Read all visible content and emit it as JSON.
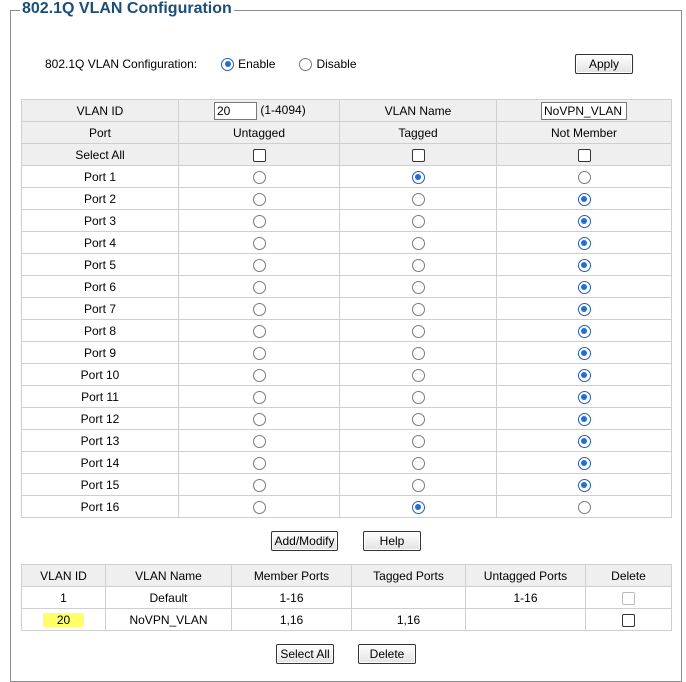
{
  "title": "802.1Q VLAN Configuration",
  "config": {
    "label": "802.1Q VLAN Configuration:",
    "enable_label": "Enable",
    "disable_label": "Disable",
    "enabled": true,
    "apply_label": "Apply"
  },
  "vlan_form": {
    "vlan_id_label": "VLAN ID",
    "vlan_id_value": "20",
    "vlan_id_range": "(1-4094)",
    "vlan_name_label": "VLAN Name",
    "vlan_name_value": "NoVPN_VLAN"
  },
  "port_table": {
    "headers": [
      "Port",
      "Untagged",
      "Tagged",
      "Not Member"
    ],
    "select_all_label": "Select All",
    "ports": [
      {
        "name": "Port 1",
        "mode": "tagged"
      },
      {
        "name": "Port 2",
        "mode": "not_member"
      },
      {
        "name": "Port 3",
        "mode": "not_member"
      },
      {
        "name": "Port 4",
        "mode": "not_member"
      },
      {
        "name": "Port 5",
        "mode": "not_member"
      },
      {
        "name": "Port 6",
        "mode": "not_member"
      },
      {
        "name": "Port 7",
        "mode": "not_member"
      },
      {
        "name": "Port 8",
        "mode": "not_member"
      },
      {
        "name": "Port 9",
        "mode": "not_member"
      },
      {
        "name": "Port 10",
        "mode": "not_member"
      },
      {
        "name": "Port 11",
        "mode": "not_member"
      },
      {
        "name": "Port 12",
        "mode": "not_member"
      },
      {
        "name": "Port 13",
        "mode": "not_member"
      },
      {
        "name": "Port 14",
        "mode": "not_member"
      },
      {
        "name": "Port 15",
        "mode": "not_member"
      },
      {
        "name": "Port 16",
        "mode": "tagged"
      }
    ]
  },
  "buttons": {
    "add_modify": "Add/Modify",
    "help": "Help",
    "select_all": "Select All",
    "delete": "Delete"
  },
  "vlan_list": {
    "headers": [
      "VLAN ID",
      "VLAN Name",
      "Member Ports",
      "Tagged Ports",
      "Untagged Ports",
      "Delete"
    ],
    "rows": [
      {
        "id": "1",
        "name": "Default",
        "member": "1-16",
        "tagged": "",
        "untagged": "1-16",
        "delete_disabled": true,
        "highlight": false
      },
      {
        "id": "20",
        "name": "NoVPN_VLAN",
        "member": "1,16",
        "tagged": "1,16",
        "untagged": "",
        "delete_disabled": false,
        "highlight": true
      }
    ]
  },
  "colors": {
    "title": "#1c4e76",
    "highlight": "#ffff66",
    "radio_selected": "#1f6fd6",
    "header_bg": "#efefef"
  }
}
